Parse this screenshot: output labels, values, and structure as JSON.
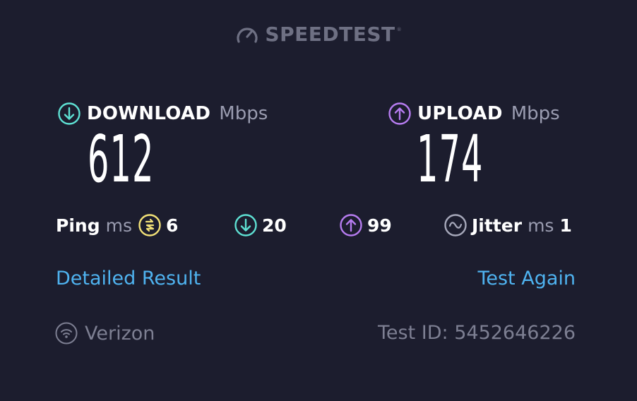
{
  "brand": {
    "name": "SPEEDTEST",
    "trademark": "®",
    "icon": "speedometer-icon"
  },
  "download": {
    "title": "DOWNLOAD",
    "unit": "Mbps",
    "value": "612",
    "icon": "download-arrow-icon",
    "color": "#5ee0d3"
  },
  "upload": {
    "title": "UPLOAD",
    "unit": "Mbps",
    "value": "174",
    "icon": "upload-arrow-icon",
    "color": "#b67cf0"
  },
  "stats": {
    "ping": {
      "label": "Ping",
      "unit": "ms",
      "value": "6",
      "icon": "ping-icon",
      "color": "#f2e177"
    },
    "download_latency": {
      "value": "20",
      "icon": "download-arrow-icon"
    },
    "upload_latency": {
      "value": "99",
      "icon": "upload-arrow-icon"
    },
    "jitter": {
      "label": "Jitter",
      "unit": "ms",
      "value": "1",
      "icon": "jitter-wave-icon",
      "color": "#a6a8ba"
    }
  },
  "actions": {
    "detailed_result": "Detailed Result",
    "test_again": "Test Again"
  },
  "footer": {
    "isp": "Verizon",
    "isp_icon": "wifi-icon",
    "test_id": "Test ID: 5452646226"
  },
  "colors": {
    "background": "#1c1d2e",
    "link": "#4fb3f0",
    "muted": "#7d7f92"
  }
}
